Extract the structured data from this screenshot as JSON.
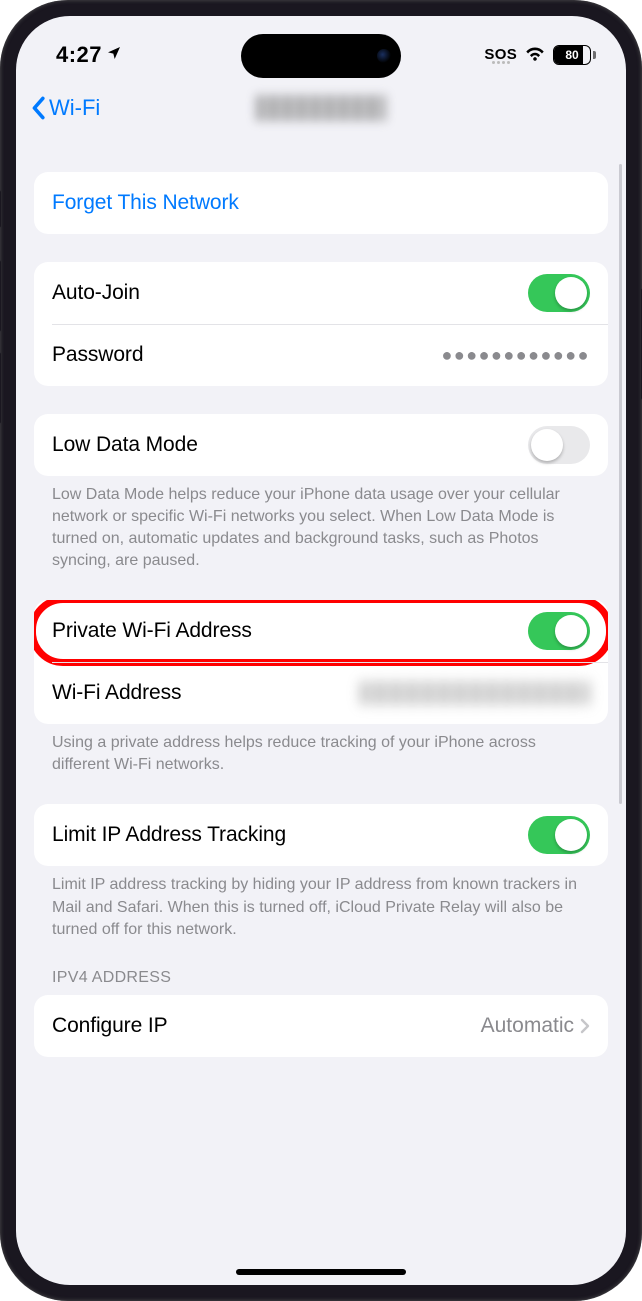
{
  "status": {
    "time": "4:27",
    "sos": "SOS",
    "battery": "80"
  },
  "nav": {
    "back_label": "Wi-Fi"
  },
  "forget": {
    "label": "Forget This Network"
  },
  "auto_join": {
    "label": "Auto-Join",
    "on": true
  },
  "password": {
    "label": "Password",
    "mask": "●●●●●●●●●●●●"
  },
  "low_data": {
    "label": "Low Data Mode",
    "on": false,
    "footer": "Low Data Mode helps reduce your iPhone data usage over your cellular network or specific Wi-Fi networks you select. When Low Data Mode is turned on, automatic updates and background tasks, such as Photos syncing, are paused."
  },
  "private_addr": {
    "label": "Private Wi-Fi Address",
    "on": true
  },
  "wifi_addr": {
    "label": "Wi-Fi Address",
    "footer": "Using a private address helps reduce tracking of your iPhone across different Wi-Fi networks."
  },
  "limit_ip": {
    "label": "Limit IP Address Tracking",
    "on": true,
    "footer": "Limit IP address tracking by hiding your IP address from known trackers in Mail and Safari. When this is turned off, iCloud Private Relay will also be turned off for this network."
  },
  "ipv4": {
    "header": "IPV4 ADDRESS",
    "configure_label": "Configure IP",
    "configure_value": "Automatic"
  }
}
